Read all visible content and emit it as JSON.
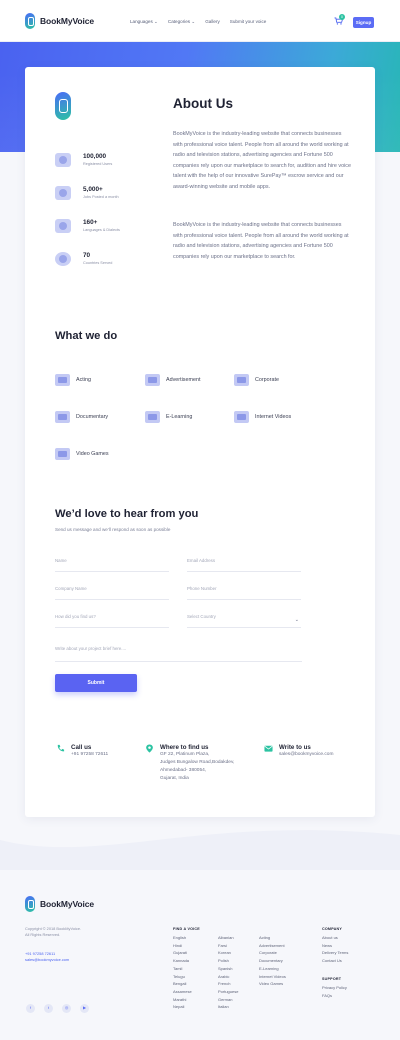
{
  "brand": {
    "prefix": "BookMy",
    "suffix": "Voice"
  },
  "header": {
    "nav": [
      "Languages ⌄",
      "Categories ⌄",
      "Gallery",
      "Submit your voice"
    ],
    "cart_count": "0",
    "signup": "Signup"
  },
  "about": {
    "title": "About Us",
    "p1": "BookMyVoice is the industry-leading website that connects businesses with professional voice talent. People from all around the world working at radio and television stations, advertising agencies and Fortune 500 companies rely upon our marketplace to search for, audition and hire voice talent with the help of our innovative SurePay™ escrow service and our award-winning website and mobile apps.",
    "p2": "BookMyVoice is the industry-leading website that connects businesses with professional voice talent. People from all around the world working at radio and television stations, advertising agencies and Fortune 500 companies rely upon our marketplace to search for.",
    "stats": [
      {
        "value": "100,000",
        "label": "Registered Users",
        "icon": "users-icon"
      },
      {
        "value": "5,000+",
        "label": "Jobs Posted a month",
        "icon": "briefcase-icon"
      },
      {
        "value": "160+",
        "label": "Languages & Dialects",
        "icon": "language-icon"
      },
      {
        "value": "70",
        "label": "Countries Served",
        "icon": "globe-icon"
      }
    ]
  },
  "what_we_do": {
    "title": "What we do",
    "items": [
      {
        "label": "Acting",
        "icon": "masks-icon"
      },
      {
        "label": "Advertisement",
        "icon": "megaphone-icon"
      },
      {
        "label": "Corporate",
        "icon": "building-icon"
      },
      {
        "label": "Documentary",
        "icon": "film-icon"
      },
      {
        "label": "E-Learning",
        "icon": "monitor-icon"
      },
      {
        "label": "Internet Videos",
        "icon": "video-icon"
      },
      {
        "label": "Video Games",
        "icon": "gamepad-icon"
      }
    ]
  },
  "contact_form": {
    "title": "We’d love to hear from you",
    "subtitle": "Send us message and we’ll respond as soon as possible",
    "name": "Name",
    "email": "Email Address",
    "company": "Company Name",
    "phone": "Phone Number",
    "found": "How did you find us?",
    "country": "Select Country",
    "message": "Write about your project brief here....",
    "submit": "Submit"
  },
  "contact_info": {
    "call_title": "Call us",
    "call_value": "+91 97258 72611",
    "find_title": "Where to find us",
    "find_lines": [
      "GF 22, Platinum Plaza,",
      "Judges Bungalow Road,Bodakdev,",
      "Ahmedabad- 380054,",
      "Gujarat, India"
    ],
    "write_title": "Write to us",
    "write_value": "sales@bookmyvoice.com"
  },
  "footer": {
    "copyright": "Copyright © 2018 BookMyVoice.",
    "rights": "All Rights Reserved.",
    "phone": "+91 97258 72611",
    "email": "sales@bookmyvoice.com",
    "find_voice_title": "FIND A VOICE",
    "languages_col1": [
      "English",
      "Hindi",
      "Gujarati",
      "Kannada",
      "Tamil",
      "Telugu",
      "Bengali",
      "Assamese",
      "Marathi",
      "Nepali"
    ],
    "languages_col2": [
      "Albanian",
      "Farsi",
      "Korean",
      "Polish",
      "Spanish",
      "Arabic",
      "French",
      "Portuguese",
      "German",
      "Italian"
    ],
    "categories_col": [
      "Acting",
      "Advertisement",
      "Corporate",
      "Documentary",
      "E-Learning",
      "Internet Videos",
      "Video Games"
    ],
    "company_title": "COMPANY",
    "company_links": [
      "About us",
      "News",
      "Delivery Terms",
      "Contact Us"
    ],
    "support_title": "SUPPORT",
    "support_links": [
      "Privacy Policy",
      "FAQs"
    ],
    "social": [
      {
        "icon": "facebook-icon",
        "glyph": "f"
      },
      {
        "icon": "twitter-icon",
        "glyph": "t"
      },
      {
        "icon": "instagram-icon",
        "glyph": "◎"
      },
      {
        "icon": "youtube-icon",
        "glyph": "▶"
      }
    ]
  },
  "colors": {
    "accent": "#5B6CF5",
    "teal": "#2CC3A2",
    "heading": "#1F2233"
  }
}
